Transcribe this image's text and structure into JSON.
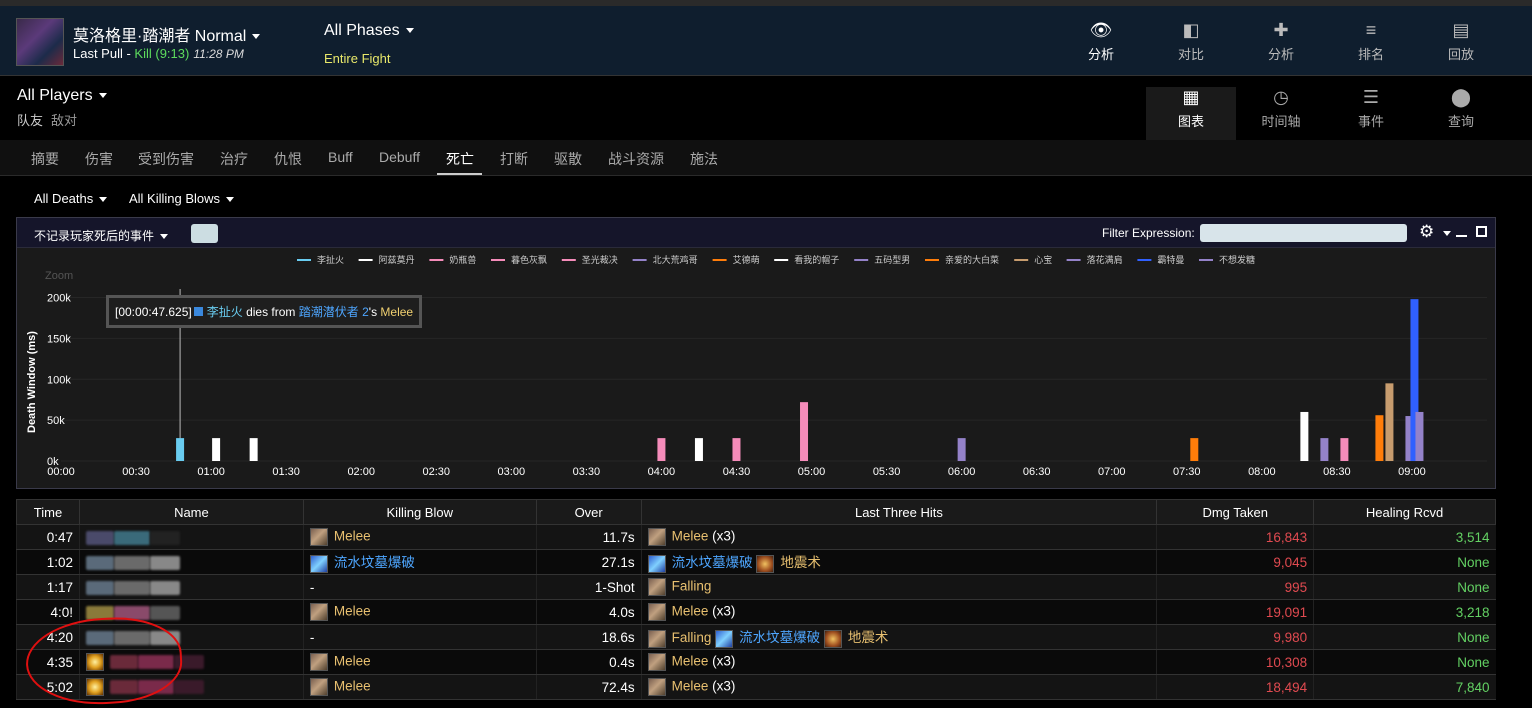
{
  "header": {
    "boss_name": "莫洛格里·踏潮者 Normal",
    "pull_label": "Last Pull - ",
    "pull_result": "Kill (9:13)",
    "pull_time": "11:28 PM",
    "phases_title": "All Phases",
    "phases_sub": "Entire Fight",
    "nav": [
      {
        "label": "分析",
        "icon": "eye-icon",
        "glyph": "👁"
      },
      {
        "label": "对比",
        "icon": "compare-icon",
        "glyph": "◧"
      },
      {
        "label": "分析",
        "icon": "puzzle-icon",
        "glyph": "✚"
      },
      {
        "label": "排名",
        "icon": "ranking-icon",
        "glyph": "≡"
      },
      {
        "label": "回放",
        "icon": "film-icon",
        "glyph": "▤"
      }
    ]
  },
  "players": {
    "title": "All Players",
    "friendly": "队友",
    "enemy": "敌对",
    "nav": [
      {
        "label": "图表",
        "icon": "grid-icon",
        "glyph": "▦"
      },
      {
        "label": "时间轴",
        "icon": "clock-icon",
        "glyph": "◷"
      },
      {
        "label": "事件",
        "icon": "list-icon",
        "glyph": "☰"
      },
      {
        "label": "查询",
        "icon": "map-pin-icon",
        "glyph": "⬤"
      }
    ]
  },
  "tabs": [
    "摘要",
    "伤害",
    "受到伤害",
    "治疗",
    "仇恨",
    "Buff",
    "Debuff",
    "死亡",
    "打断",
    "驱散",
    "战斗资源",
    "施法"
  ],
  "filters": {
    "deaths": "All Deaths",
    "killing_blows": "All Killing Blows"
  },
  "chart_panel": {
    "no_record_label": "不记录玩家死后的事件",
    "filter_label": "Filter Expression:",
    "filter_value": ""
  },
  "chart_data": {
    "type": "bar",
    "ylabel": "Death Window (ms)",
    "zoom_label": "Zoom",
    "ylim": [
      0,
      230000
    ],
    "yticks": [
      0,
      50000,
      100000,
      150000,
      200000
    ],
    "ytick_labels": [
      "0k",
      "50k",
      "100k",
      "150k",
      "200k"
    ],
    "xlim": [
      0,
      570
    ],
    "xticks": [
      0,
      30,
      60,
      90,
      120,
      150,
      180,
      210,
      240,
      270,
      300,
      330,
      360,
      390,
      420,
      450,
      480,
      510,
      540
    ],
    "xtick_labels": [
      "00:00",
      "00:30",
      "01:00",
      "01:30",
      "02:00",
      "02:30",
      "03:00",
      "03:30",
      "04:00",
      "04:30",
      "05:00",
      "05:30",
      "06:00",
      "06:30",
      "07:00",
      "07:30",
      "08:00",
      "08:30",
      "09:00"
    ],
    "legend": [
      {
        "name": "李扯火",
        "color": "#69ccf0"
      },
      {
        "name": "阿兹莫丹",
        "color": "#ffffff"
      },
      {
        "name": "奶瓶兽",
        "color": "#f58cba"
      },
      {
        "name": "暮色灰飘",
        "color": "#f58cba"
      },
      {
        "name": "圣光裁决",
        "color": "#f58cba"
      },
      {
        "name": "北大荒鸡哥",
        "color": "#9482c9"
      },
      {
        "name": "艾德萌",
        "color": "#ff7d0a"
      },
      {
        "name": "看我的帽子",
        "color": "#ffffff"
      },
      {
        "name": "五码型男",
        "color": "#9482c9"
      },
      {
        "name": "亲爱的大白菜",
        "color": "#ff7d0a"
      },
      {
        "name": "心宝",
        "color": "#c79c6e"
      },
      {
        "name": "落花满肩",
        "color": "#9482c9"
      },
      {
        "name": "霸特曼",
        "color": "#3060ff"
      },
      {
        "name": "不想发糖",
        "color": "#9482c9"
      }
    ],
    "bars": [
      {
        "t": 47.6,
        "v": 28000,
        "color": "#69ccf0"
      },
      {
        "t": 62,
        "v": 28000,
        "color": "#ffffff"
      },
      {
        "t": 77,
        "v": 28000,
        "color": "#ffffff"
      },
      {
        "t": 240,
        "v": 28000,
        "color": "#f58cba"
      },
      {
        "t": 255,
        "v": 28000,
        "color": "#ffffff"
      },
      {
        "t": 270,
        "v": 28000,
        "color": "#f58cba"
      },
      {
        "t": 297,
        "v": 72000,
        "color": "#f58cba"
      },
      {
        "t": 360,
        "v": 28000,
        "color": "#9482c9"
      },
      {
        "t": 453,
        "v": 28000,
        "color": "#ff7d0a"
      },
      {
        "t": 497,
        "v": 60000,
        "color": "#ffffff"
      },
      {
        "t": 505,
        "v": 28000,
        "color": "#9482c9"
      },
      {
        "t": 513,
        "v": 28000,
        "color": "#f58cba"
      },
      {
        "t": 527,
        "v": 56000,
        "color": "#ff7d0a"
      },
      {
        "t": 531,
        "v": 95000,
        "color": "#c79c6e"
      },
      {
        "t": 539,
        "v": 55000,
        "color": "#9482c9"
      },
      {
        "t": 541,
        "v": 198000,
        "color": "#3060ff"
      },
      {
        "t": 543,
        "v": 60000,
        "color": "#9482c9"
      }
    ],
    "tooltip": {
      "time": "[00:00:47.625]",
      "player": "李扯火",
      "text1": " dies from ",
      "enemy": "踏潮潜伏者 2",
      "text2": "'s ",
      "ability": "Melee"
    }
  },
  "table": {
    "headers": [
      "Time",
      "Name",
      "Killing Blow",
      "Over",
      "Last Three Hits",
      "Dmg Taken",
      "Healing Rcvd"
    ],
    "rows": [
      {
        "time": "0:47",
        "kb": "Melee",
        "kb_icon": "melee",
        "over": "11.7s",
        "hits": [
          {
            "name": "Melee (x3)",
            "icon": "melee"
          }
        ],
        "dmg": "16,843",
        "heal": "3,514"
      },
      {
        "time": "1:02",
        "kb": "流水坟墓爆破",
        "kb_icon": "water",
        "over": "27.1s",
        "hits": [
          {
            "name": "流水坟墓爆破",
            "icon": "water"
          },
          {
            "name": "地震术",
            "icon": "quake"
          }
        ],
        "dmg": "9,045",
        "heal": "None"
      },
      {
        "time": "1:17",
        "kb": "-",
        "kb_icon": "",
        "over": "1-Shot",
        "hits": [
          {
            "name": "Falling",
            "icon": "fall"
          }
        ],
        "dmg": "995",
        "heal": "None"
      },
      {
        "time": "4:0!",
        "kb": "Melee",
        "kb_icon": "melee",
        "over": "4.0s",
        "hits": [
          {
            "name": "Melee (x3)",
            "icon": "melee"
          }
        ],
        "dmg": "19,091",
        "heal": "3,218"
      },
      {
        "time": "4:20",
        "kb": "-",
        "kb_icon": "",
        "over": "18.6s",
        "hits": [
          {
            "name": "Falling",
            "icon": "fall"
          },
          {
            "name": "流水坟墓爆破",
            "icon": "water"
          },
          {
            "name": "地震术",
            "icon": "quake"
          }
        ],
        "dmg": "9,980",
        "heal": "None"
      },
      {
        "time": "4:35",
        "kb": "Melee",
        "kb_icon": "melee",
        "over": "0.4s",
        "hits": [
          {
            "name": "Melee (x3)",
            "icon": "melee"
          }
        ],
        "dmg": "10,308",
        "heal": "None"
      },
      {
        "time": "5:02",
        "kb": "Melee",
        "kb_icon": "melee",
        "over": "72.4s",
        "hits": [
          {
            "name": "Melee (x3)",
            "icon": "melee"
          }
        ],
        "dmg": "18,494",
        "heal": "7,840"
      }
    ]
  }
}
